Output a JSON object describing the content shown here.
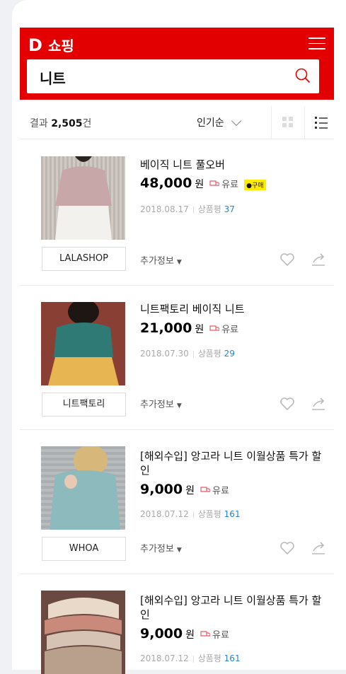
{
  "header": {
    "logo_letter": "D",
    "logo_text": "쇼핑",
    "search_value": "니트"
  },
  "sortbar": {
    "result_prefix": "결과 ",
    "result_count": "2,505",
    "result_suffix": "건",
    "sort_label": "인기순"
  },
  "items": [
    {
      "title": "베이직 니트 풀오버",
      "price": "48,000",
      "won": "원",
      "shipping": "유료",
      "badge": "구매",
      "date": "2018.08.17",
      "review_label": "상품평",
      "review_count": "37",
      "shop": "LALASHOP",
      "extra": "추가정보"
    },
    {
      "title": "니트팩토리 베이직 니트",
      "price": "21,000",
      "won": "원",
      "shipping": "유료",
      "date": "2018.07.30",
      "review_label": "상품평",
      "review_count": "29",
      "shop": "니트팩토리",
      "extra": "추가정보"
    },
    {
      "title": "[해외수입] 앙고라 니트 이월상품 특가 할인",
      "price": "9,000",
      "won": "원",
      "shipping": "유료",
      "date": "2018.07.12",
      "review_label": "상품평",
      "review_count": "161",
      "shop": "WHOA",
      "extra": "추가정보"
    },
    {
      "title": "[해외수입] 앙고라 니트 이월상품 특가 할인",
      "price": "9,000",
      "won": "원",
      "shipping": "유료",
      "date": "2018.07.12",
      "review_label": "상품평",
      "review_count": "161"
    }
  ],
  "colors": {
    "brand": "#e30000",
    "link": "#2a82d7",
    "badge": "#ffeb00"
  },
  "icons": [
    "menu-icon",
    "search-icon",
    "chevron-down-icon",
    "grid-view-icon",
    "list-view-icon",
    "shipping-icon",
    "chat-icon",
    "heart-icon",
    "share-icon"
  ]
}
